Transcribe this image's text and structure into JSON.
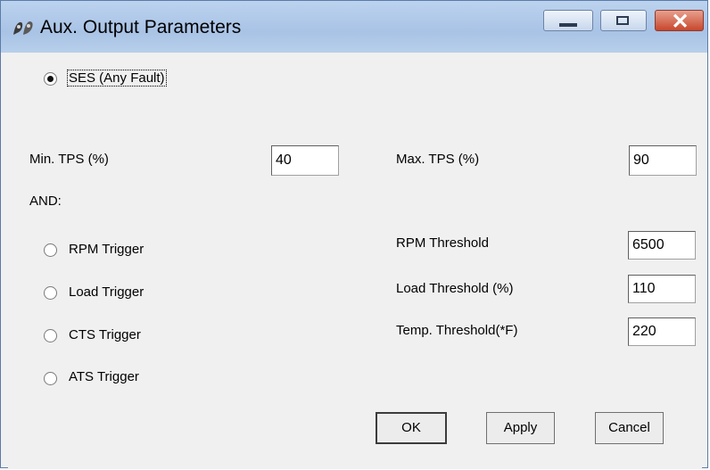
{
  "window": {
    "title": "Aux. Output Parameters",
    "close_glyph": "✕"
  },
  "mode": {
    "ses_label": "SES (Any Fault)",
    "ses_selected": true
  },
  "tps": {
    "min_label": "Min. TPS (%)",
    "min_value": "40",
    "max_label": "Max. TPS (%)",
    "max_value": "90"
  },
  "and_label": "AND:",
  "triggers": {
    "rpm_label": "RPM Trigger",
    "load_label": "Load Trigger",
    "cts_label": "CTS Trigger",
    "ats_label": "ATS Trigger"
  },
  "thresholds": {
    "rpm_label": "RPM Threshold",
    "rpm_value": "6500",
    "load_label": "Load Threshold (%)",
    "load_value": "110",
    "temp_label": "Temp. Threshold(*F)",
    "temp_value": "220"
  },
  "buttons": {
    "ok_label": "OK",
    "apply_label": "Apply",
    "cancel_label": "Cancel"
  }
}
